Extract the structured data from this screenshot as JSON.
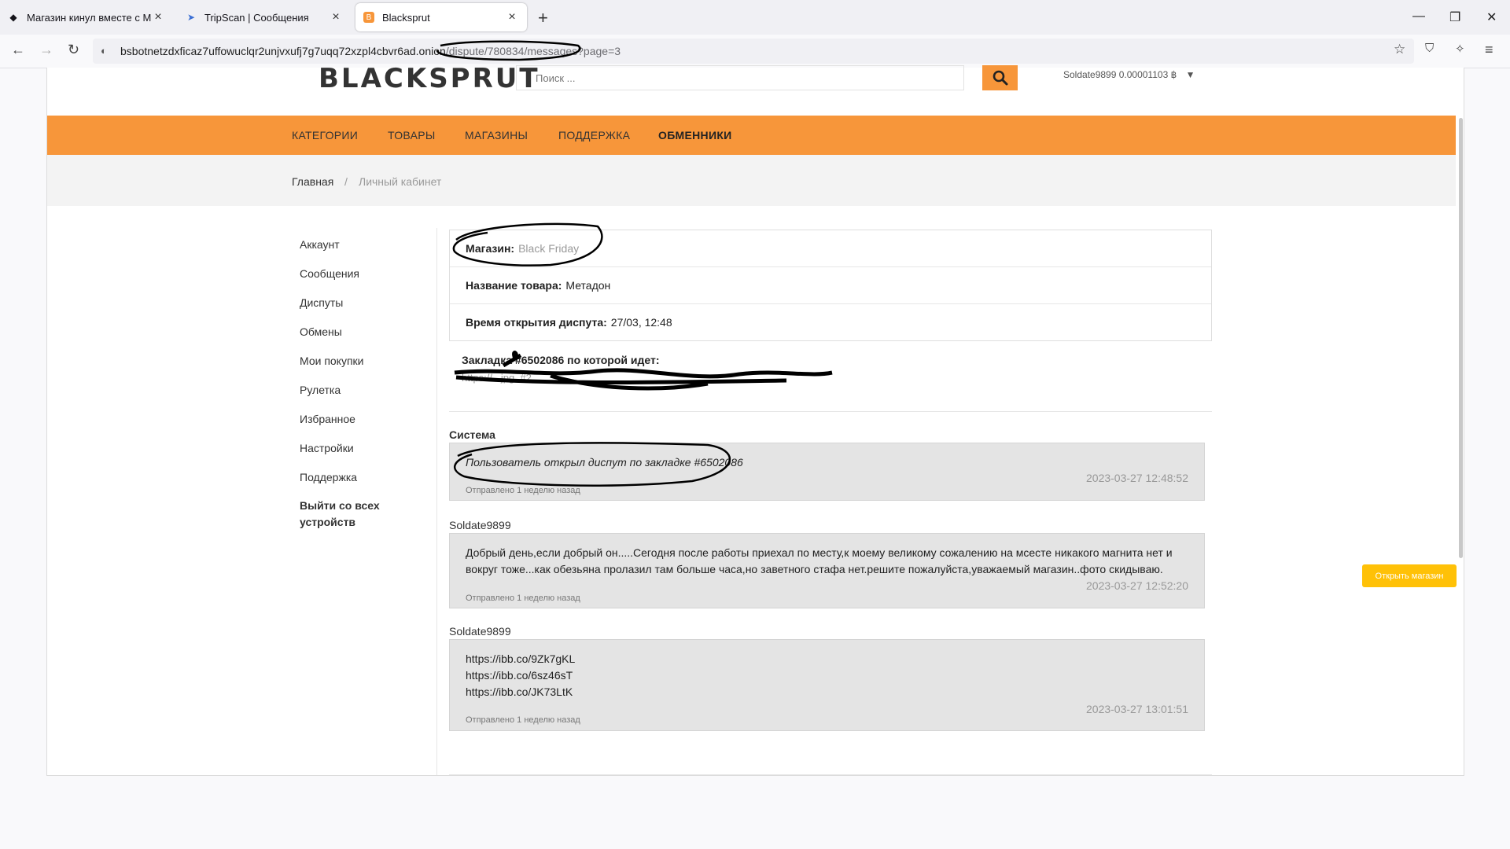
{
  "browser": {
    "tabs": [
      {
        "label": "Магазин кинул вместе с Моде",
        "icon": "diamond-icon"
      },
      {
        "label": "TripScan | Сообщения",
        "icon": "paper-plane-icon"
      },
      {
        "label": "Blacksprut",
        "icon": "blacksprut-favicon"
      }
    ],
    "url_host": "bsbotnetzdxficaz7uffowuclqr2unjvxufj7g7uqq72xzpl4cbvr6ad.onion",
    "url_path": "/dispute/780834/messages?page=3"
  },
  "header": {
    "logo_text": "BLACKSPRUT",
    "search_placeholder": "Поиск ...",
    "user_balance": "Soldate9899 0.00001103 ฿"
  },
  "menu": [
    "КАТЕГОРИИ",
    "ТОВАРЫ",
    "МАГАЗИНЫ",
    "ПОДДЕРЖКА",
    "ОБМЕННИКИ"
  ],
  "breadcrumb": {
    "home": "Главная",
    "separator": "/",
    "current": "Личный кабинет"
  },
  "sidebar": [
    "Аккаунт",
    "Сообщения",
    "Диспуты",
    "Обмены",
    "Мои покупки",
    "Рулетка",
    "Избранное",
    "Настройки",
    "Поддержка",
    "Выйти со всех устройств"
  ],
  "dispute": {
    "shop_label": "Магазин:",
    "shop_value": "Black Friday",
    "product_label": "Название товара:",
    "product_value": "Метадон",
    "opened_label": "Время открытия диспута:",
    "opened_value": "27/03, 12:48",
    "bookmark_title": "Закладка #6502086 по которой идет:",
    "bookmark_link": "https://...jpg. #2"
  },
  "messages": [
    {
      "author": "Система",
      "text": "Пользователь открыл диспут по закладке #6502086",
      "timestamp": "2023-03-27 12:48:52",
      "sent": "Отправлено 1 неделю назад"
    },
    {
      "author": "Soldate9899",
      "text": "Добрый день,если добрый он.....Сегодня после работы приехал по месту,к моему великому сожалению на мсесте никакого магнита нет и вокруг тоже...как обезьяна пролазил там больше часа,но заветного стафа нет.решите пожалуйста,уважаемый магазин..фото скидываю.",
      "timestamp": "2023-03-27 12:52:20",
      "sent": "Отправлено 1 неделю назад"
    },
    {
      "author": "Soldate9899",
      "links": [
        "https://ibb.co/9Zk7gKL",
        "https://ibb.co/6sz46sT",
        "https://ibb.co/JK73LtK"
      ],
      "timestamp": "2023-03-27 13:01:51",
      "sent": "Отправлено 1 неделю назад"
    }
  ],
  "open_shop_button": "Открыть магазин",
  "colors": {
    "accent_orange": "#f7963a",
    "open_shop_yellow": "#ffc107",
    "message_bg": "#e4e4e4"
  }
}
